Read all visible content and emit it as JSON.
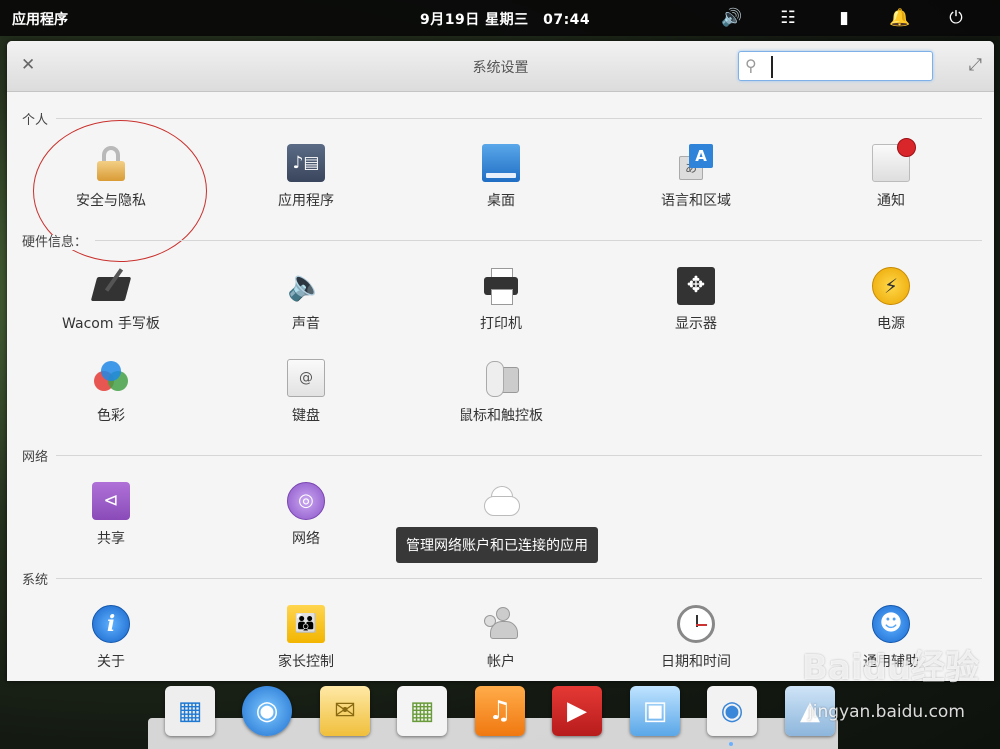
{
  "panel": {
    "apps_label": "应用程序",
    "clock": "9月19日 星期三　07:44",
    "tray_icons": [
      "volume-icon",
      "network-icon",
      "battery-icon",
      "bell-icon",
      "power-icon"
    ]
  },
  "window": {
    "title": "系统设置",
    "search": {
      "value": "",
      "placeholder": ""
    }
  },
  "sections": {
    "personal": {
      "title": "个人",
      "items": [
        {
          "label": "安全与隐私",
          "icon": "lock-icon"
        },
        {
          "label": "应用程序",
          "icon": "applications-icon"
        },
        {
          "label": "桌面",
          "icon": "desktop-icon"
        },
        {
          "label": "语言和区域",
          "icon": "language-icon"
        },
        {
          "label": "通知",
          "icon": "notifications-icon"
        }
      ]
    },
    "hardware": {
      "title": "硬件信息：",
      "items": [
        {
          "label": "Wacom 手写板",
          "icon": "tablet-icon"
        },
        {
          "label": "声音",
          "icon": "speaker-icon"
        },
        {
          "label": "打印机",
          "icon": "printer-icon"
        },
        {
          "label": "显示器",
          "icon": "display-icon"
        },
        {
          "label": "电源",
          "icon": "power-icon"
        },
        {
          "label": "色彩",
          "icon": "color-icon"
        },
        {
          "label": "键盘",
          "icon": "keyboard-icon"
        },
        {
          "label": "鼠标和触控板",
          "icon": "mouse-icon"
        }
      ]
    },
    "network": {
      "title": "网络",
      "items": [
        {
          "label": "共享",
          "icon": "share-icon"
        },
        {
          "label": "网络",
          "icon": "network-icon"
        },
        {
          "label": "",
          "icon": "cloud-icon"
        }
      ]
    },
    "system": {
      "title": "系统",
      "items": [
        {
          "label": "关于",
          "icon": "info-icon"
        },
        {
          "label": "家长控制",
          "icon": "parental-control-icon"
        },
        {
          "label": "帐户",
          "icon": "users-icon"
        },
        {
          "label": "日期和时间",
          "icon": "clock-icon"
        },
        {
          "label": "通用辅助",
          "icon": "accessibility-icon"
        }
      ]
    }
  },
  "tooltip": "管理网络账户和已连接的应用",
  "dock": {
    "items": [
      "multitasking-icon",
      "browser-icon",
      "mail-icon",
      "calendar-icon",
      "music-icon",
      "video-icon",
      "photos-icon",
      "settings-icon",
      "store-icon"
    ]
  },
  "watermark": {
    "brand": "Baidu经验",
    "site": "jingyan.baidu.com"
  }
}
